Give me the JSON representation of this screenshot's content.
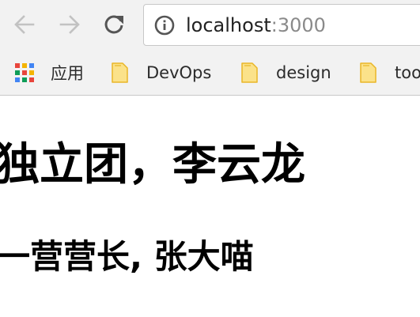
{
  "address_bar": {
    "host": "localhost",
    "port": ":3000"
  },
  "bookmarks": [
    {
      "label": "应用",
      "icon": "apps-grid-icon"
    },
    {
      "label": "DevOps",
      "icon": "folder-icon"
    },
    {
      "label": "design",
      "icon": "folder-icon"
    },
    {
      "label": "too",
      "icon": "folder-icon"
    }
  ],
  "page": {
    "heading": "独立团，李云龙",
    "subheading": "一营营长, 张大喵"
  },
  "colors": {
    "chrome_bg": "#f2f2f2",
    "folder_fill": "#fbe28a",
    "folder_stroke": "#e9b627",
    "nav_disabled": "#c2c2c2",
    "nav_enabled": "#555555",
    "url_port": "#8a8a8a"
  }
}
